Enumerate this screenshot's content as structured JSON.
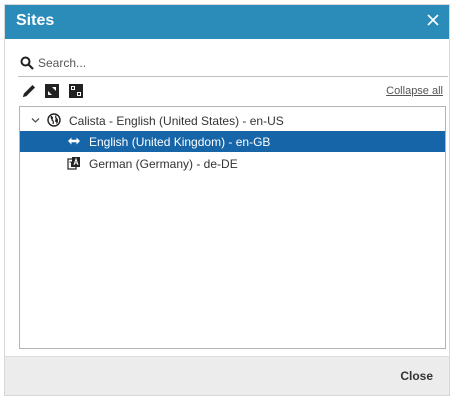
{
  "dialog": {
    "title": "Sites",
    "close_icon": "close-icon"
  },
  "search": {
    "placeholder": "Search...",
    "value": "",
    "icon": "search-icon"
  },
  "toolbar": {
    "buttons": [
      {
        "icon": "pencil-icon"
      },
      {
        "icon": "expand-square-icon"
      },
      {
        "icon": "fullscreen-icon"
      }
    ],
    "collapse_all_label": "Collapse all"
  },
  "tree": {
    "root": {
      "label": "Calista - English (United States) - en-US",
      "icon": "globe-icon",
      "expanded": true,
      "children": [
        {
          "label": "English (United Kingdom) - en-GB",
          "icon": "arrows-left-right-icon",
          "selected": true
        },
        {
          "label": "German (Germany) - de-DE",
          "icon": "translate-icon",
          "selected": false
        }
      ]
    }
  },
  "footer": {
    "close_label": "Close"
  },
  "colors": {
    "titlebar": "#2b8cba",
    "selection": "#1565a8",
    "footer": "#ececec"
  }
}
